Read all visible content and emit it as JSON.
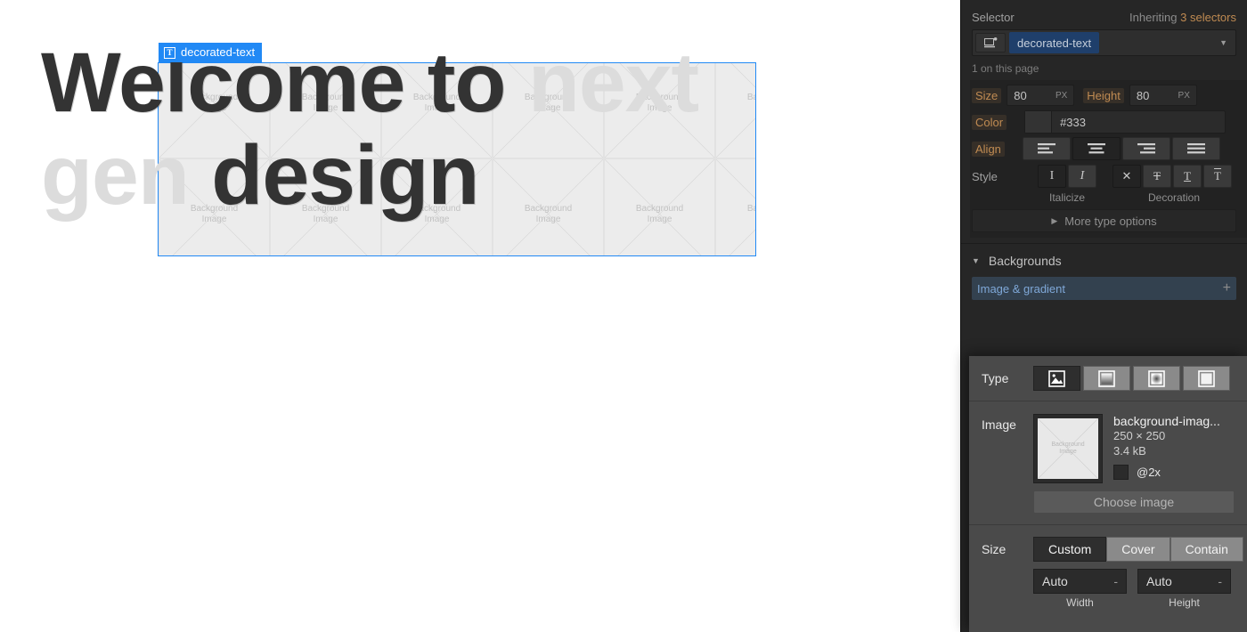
{
  "canvas": {
    "selection_badge": {
      "icon": "text-element-icon",
      "label": "decorated-text"
    },
    "heading_part1": "Welcome to ",
    "heading_masked1": "next",
    "heading_masked2": "gen",
    "heading_part2": " design",
    "background_tile_line1": "Background",
    "background_tile_line2": "Image",
    "selection_color": "#2189f5"
  },
  "panel": {
    "selector": {
      "label": "Selector",
      "inheriting_prefix": "Inheriting ",
      "inheriting_count": "3 selectors",
      "device_icon": "device-breakpoint-icon",
      "tag": "decorated-text",
      "caret_icon": "chevron-down-icon",
      "count_note": "1 on this page",
      "tag_color": "#1f3f6b"
    },
    "typography": {
      "size_label": "Size",
      "size_value": "80",
      "size_unit": "PX",
      "height_label": "Height",
      "height_value": "80",
      "height_unit": "PX",
      "color_label": "Color",
      "color_value": "#333",
      "align_label": "Align",
      "align_options": [
        "align-left-icon",
        "align-center-icon",
        "align-right-icon",
        "align-justify-icon"
      ],
      "align_selected": 1,
      "style_label": "Style",
      "italicize_caption": "Italicize",
      "italicize_options": [
        "upright-icon",
        "italic-icon"
      ],
      "italicize_selected": 0,
      "decoration_caption": "Decoration",
      "decoration_options": [
        "no-decoration-icon",
        "strikethrough-icon",
        "underline-icon",
        "overline-icon"
      ],
      "decoration_selected": 0,
      "more_options_label": "More type options",
      "more_options_icon": "triangle-right-icon",
      "highlight_color": "#c08b52"
    },
    "backgrounds": {
      "section_icon": "triangle-down-icon",
      "section_label": "Backgrounds",
      "layer_label": "Image & gradient",
      "add_icon": "plus-icon"
    }
  },
  "overlay": {
    "type_label": "Type",
    "type_options": [
      "image-icon",
      "linear-gradient-icon",
      "radial-gradient-icon",
      "solid-color-icon"
    ],
    "type_selected": 0,
    "image_label": "Image",
    "thumb_line1": "Background",
    "thumb_line2": "Image",
    "image_name": "background-imag...",
    "image_dimensions": "250 × 250",
    "image_filesize": "3.4 kB",
    "retina_label": "@2x",
    "choose_image_label": "Choose image",
    "size_label": "Size",
    "size_options": [
      "Custom",
      "Cover",
      "Contain"
    ],
    "size_selected": 0,
    "width_value": "Auto",
    "width_caption": "Width",
    "height_value": "Auto",
    "height_caption": "Height",
    "stepper_glyph": "-"
  }
}
